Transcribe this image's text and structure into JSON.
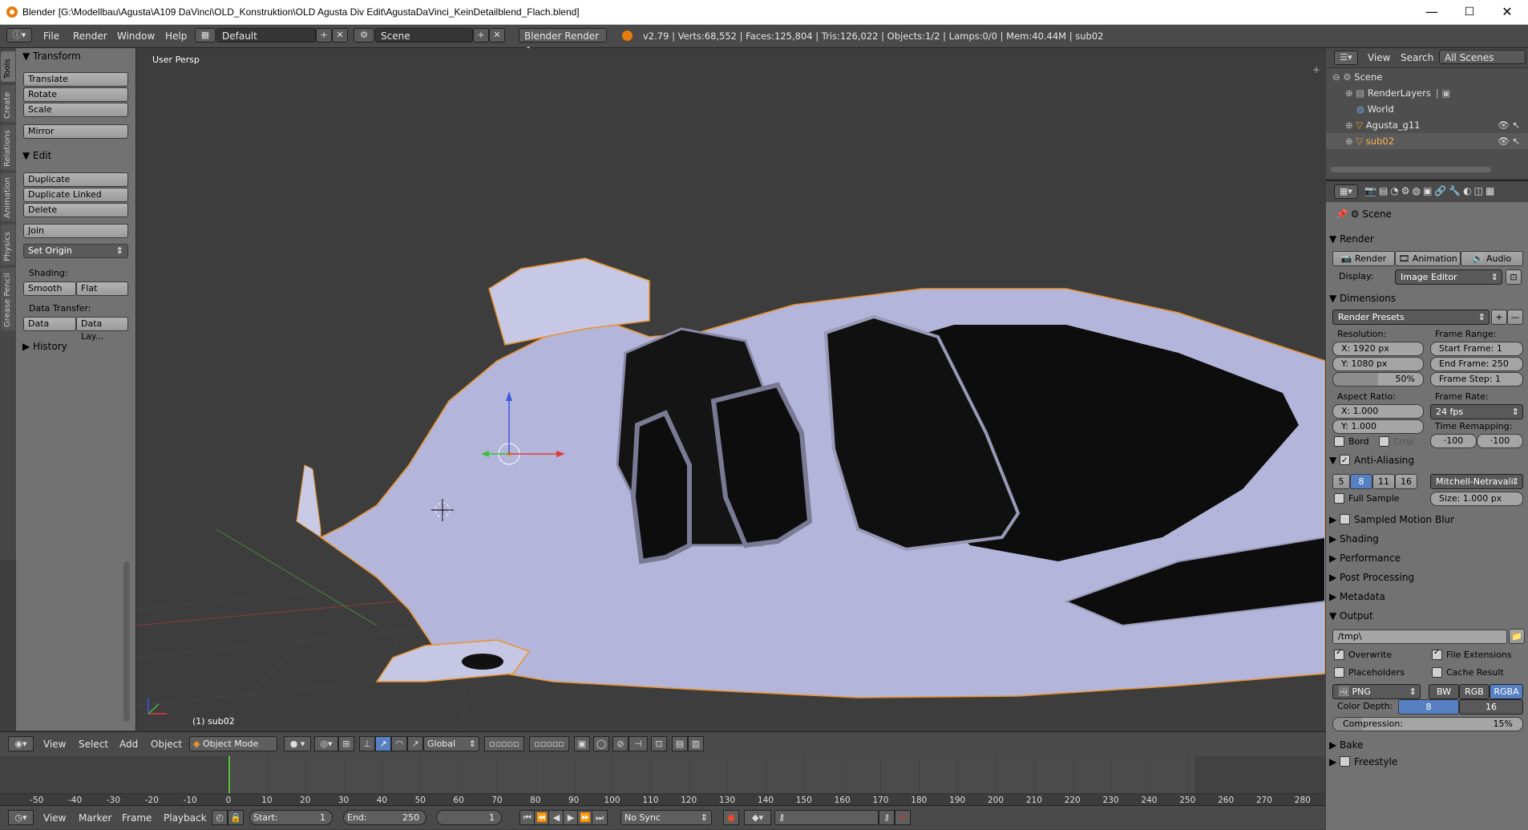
{
  "titlebar": {
    "title": "Blender [G:\\Modellbau\\Agusta\\A109 DaVinci\\OLD_Konstruktion\\OLD Agusta Div Edit\\AgustaDaVinci_KeinDetailblend_Flach.blend]",
    "minimize": "—",
    "maximize": "☐",
    "close": "✕"
  },
  "info": {
    "menus": [
      "File",
      "Render",
      "Window",
      "Help"
    ],
    "layout": "Default",
    "scene": "Scene",
    "engine": "Blender Render",
    "stats": "v2.79 | Verts:68,552 | Faces:125,804 | Tris:126,022 | Objects:1/2 | Lamps:0/0 | Mem:40.44M | sub02"
  },
  "left_tabs": [
    "Tools",
    "Create",
    "Relations",
    "Animation",
    "Physics",
    "Grease Pencil"
  ],
  "toolshelf": {
    "transform_title": "Transform",
    "translate": "Translate",
    "rotate": "Rotate",
    "scale": "Scale",
    "mirror": "Mirror",
    "edit_title": "Edit",
    "duplicate": "Duplicate",
    "duplicate_linked": "Duplicate Linked",
    "delete": "Delete",
    "join": "Join",
    "set_origin": "Set Origin",
    "shading_label": "Shading:",
    "smooth": "Smooth",
    "flat": "Flat",
    "data_transfer_label": "Data Transfer:",
    "data": "Data",
    "data_layout": "Data Lay...",
    "history_title": "History"
  },
  "viewport": {
    "view_name": "User Persp",
    "object_label": "(1) sub02",
    "menus": [
      "View",
      "Select",
      "Add",
      "Object"
    ],
    "mode": "Object Mode",
    "orientation": "Global"
  },
  "timeline": {
    "ticks": [
      -50,
      -40,
      -30,
      -20,
      -10,
      0,
      10,
      20,
      30,
      40,
      50,
      60,
      70,
      80,
      90,
      100,
      110,
      120,
      130,
      140,
      150,
      160,
      170,
      180,
      190,
      200,
      210,
      220,
      230,
      240,
      250,
      260,
      270,
      280
    ],
    "current_frame": 1,
    "menus": [
      "View",
      "Marker",
      "Frame",
      "Playback"
    ],
    "start_label": "Start:",
    "start_value": "1",
    "end_label": "End:",
    "end_value": "250",
    "frame_value": "1",
    "sync": "No Sync"
  },
  "outliner": {
    "menus": [
      "View",
      "Search"
    ],
    "filter": "All Scenes",
    "rows": [
      {
        "label": "Scene",
        "indent": 0
      },
      {
        "label": "RenderLayers",
        "indent": 1
      },
      {
        "label": "World",
        "indent": 1
      },
      {
        "label": "Agusta_g11",
        "indent": 1
      },
      {
        "label": "sub02",
        "indent": 1
      }
    ]
  },
  "properties": {
    "context": "Scene",
    "render_title": "Render",
    "render_btn": "Render",
    "animation_btn": "Animation",
    "audio_btn": "Audio",
    "display_label": "Display:",
    "display_value": "Image Editor",
    "dimensions_title": "Dimensions",
    "render_presets": "Render Presets",
    "resolution_label": "Resolution:",
    "res_x": "X:  1920 px",
    "res_y": "Y:  1080 px",
    "res_pct": "50%",
    "frame_range_label": "Frame Range:",
    "start_frame": "Start Frame:  1",
    "end_frame": "End Frame:  250",
    "frame_step": "Frame Step:  1",
    "aspect_label": "Aspect Ratio:",
    "asp_x": "X:  1.000",
    "asp_y": "Y:  1.000",
    "frame_rate_label": "Frame Rate:",
    "fps": "24 fps",
    "time_remap_label": "Time Remapping:",
    "remap_old": "·100",
    "remap_new": "·100",
    "bord": "Bord",
    "crop": "Crop",
    "aa_title": "Anti-Aliasing",
    "aa_samples": [
      "5",
      "8",
      "11",
      "16"
    ],
    "aa_filter": "Mitchell-Netravali",
    "full_sample": "Full Sample",
    "size": "Size:  1.000 px",
    "motion_blur": "Sampled Motion Blur",
    "shading": "Shading",
    "performance": "Performance",
    "post_processing": "Post Processing",
    "metadata": "Metadata",
    "output_title": "Output",
    "output_path": "/tmp\\",
    "overwrite": "Overwrite",
    "file_extensions": "File Extensions",
    "placeholders": "Placeholders",
    "cache_result": "Cache Result",
    "format": "PNG",
    "bw": "BW",
    "rgb": "RGB",
    "rgba": "RGBA",
    "color_depth_label": "Color Depth:",
    "depth_8": "8",
    "depth_16": "16",
    "compression": "Compression:",
    "compression_value": "15%",
    "bake": "Bake",
    "freestyle": "Freestyle"
  }
}
